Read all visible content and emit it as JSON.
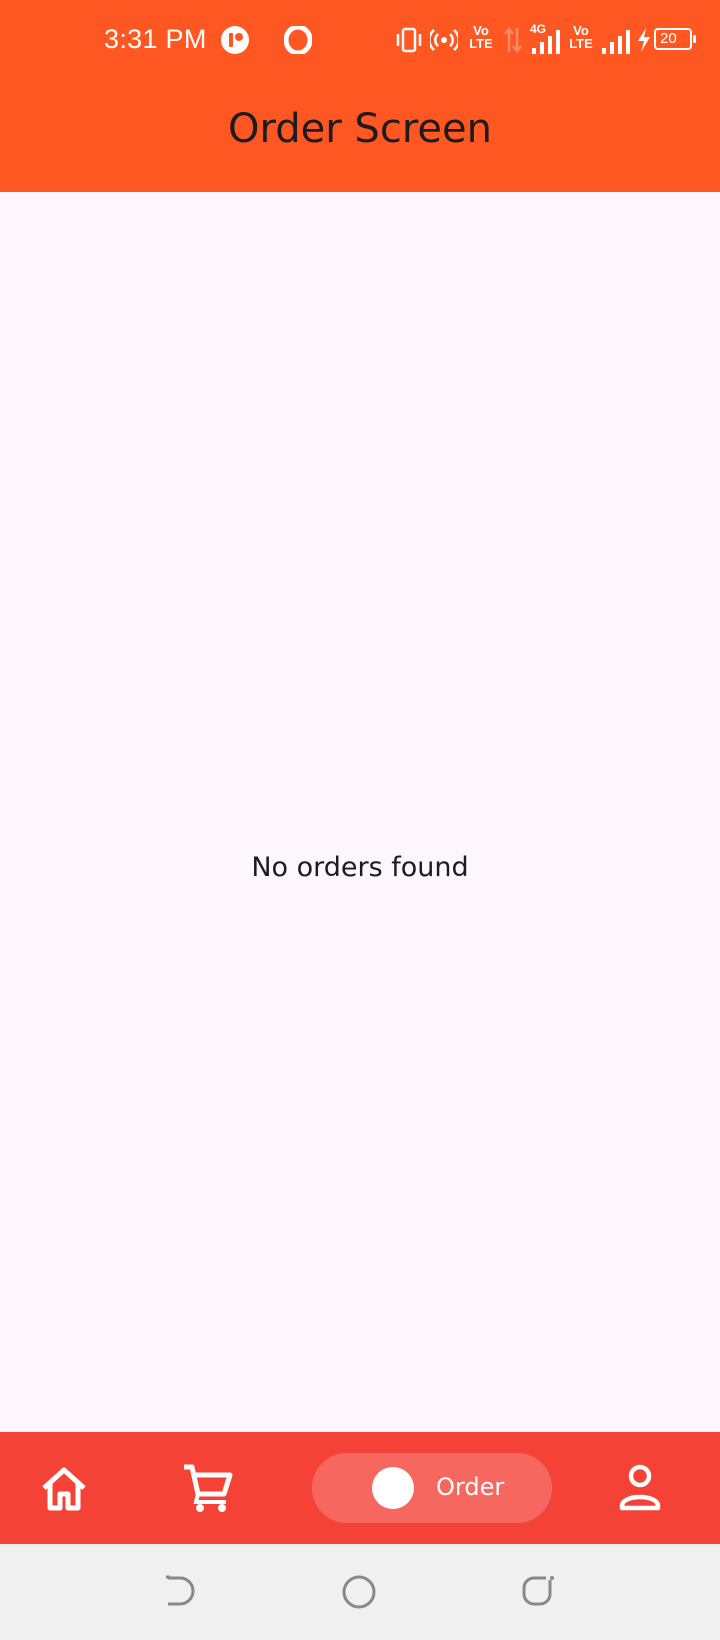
{
  "status_bar": {
    "time": "3:31 PM",
    "network_labels": [
      "Vo LTE",
      "4G",
      "Vo LTE"
    ],
    "battery_level": "20",
    "icons": [
      "app-notification-icon",
      "opera-icon",
      "vibrate-icon",
      "hotspot-icon",
      "volte-icon",
      "data-arrows-icon",
      "signal-4g-icon",
      "volte-icon",
      "signal-icon",
      "charging-icon",
      "battery-icon"
    ]
  },
  "app_bar": {
    "title": "Order Screen",
    "background_color": "#ff5722"
  },
  "main": {
    "empty_message": "No orders found"
  },
  "bottom_nav": {
    "background_color": "#f44336",
    "items": [
      {
        "icon": "home-icon",
        "label": ""
      },
      {
        "icon": "cart-icon",
        "label": ""
      },
      {
        "icon": "order-icon",
        "label": "Order",
        "selected": true
      },
      {
        "icon": "profile-icon",
        "label": ""
      }
    ]
  },
  "system_nav": {
    "buttons": [
      "back-icon",
      "home-circle-icon",
      "recents-icon"
    ]
  }
}
